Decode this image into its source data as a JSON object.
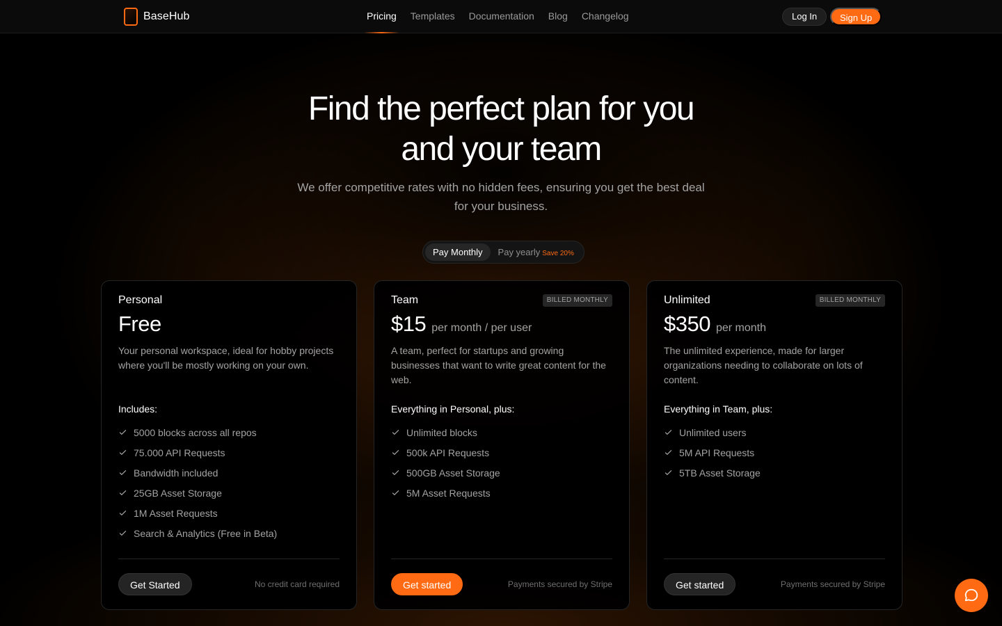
{
  "nav": {
    "brand": "BaseHub",
    "links": [
      {
        "label": "Pricing",
        "active": true
      },
      {
        "label": "Templates"
      },
      {
        "label": "Documentation"
      },
      {
        "label": "Blog"
      },
      {
        "label": "Changelog"
      }
    ],
    "login_label": "Log In",
    "signup_label": "Sign Up"
  },
  "hero": {
    "title_line1": "Find the perfect plan for you",
    "title_line2": "and your team",
    "subtitle": "We offer competitive rates with no hidden fees, ensuring you get the best deal for your business."
  },
  "billing_toggle": {
    "monthly_label": "Pay Monthly",
    "yearly_label": "Pay yearly",
    "save_label": "Save 20%",
    "selected": "monthly"
  },
  "plans": [
    {
      "name": "Personal",
      "badge": "",
      "price": "Free",
      "price_unit": "",
      "description": "Your personal workspace, ideal for hobby projects where you'll be mostly working on your own.",
      "includes_title": "Includes:",
      "features": [
        "5000 blocks across all repos",
        "75.000 API Requests",
        "Bandwidth included",
        "25GB Asset Storage",
        "1M Asset Requests",
        "Search & Analytics (Free in Beta)"
      ],
      "cta_label": "Get Started",
      "cta_note": "No credit card required"
    },
    {
      "name": "Team",
      "badge": "BILLED MONTHLY",
      "price": "$15",
      "price_unit": "per month / per user",
      "description": "A team, perfect for startups and growing businesses that want to write great content for the web.",
      "includes_title": "Everything in Personal, plus:",
      "features": [
        "Unlimited blocks",
        "500k API Requests",
        "500GB Asset Storage",
        "5M Asset Requests"
      ],
      "cta_label": "Get started",
      "cta_note": "Payments secured by Stripe"
    },
    {
      "name": "Unlimited",
      "badge": "BILLED MONTHLY",
      "price": "$350",
      "price_unit": "per month",
      "description": "The unlimited experience, made for larger organizations needing to collaborate on lots of content.",
      "includes_title": "Everything in Team, plus:",
      "features": [
        "Unlimited users",
        "5M API Requests",
        "5TB Asset Storage"
      ],
      "cta_label": "Get started",
      "cta_note": "Payments secured by Stripe"
    }
  ],
  "colors": {
    "accent": "#ff6a13",
    "background": "#000000",
    "muted_text": "#a3a3a3"
  },
  "icons": {
    "feature_bullet": "check-icon",
    "chat": "chat-bubble-icon"
  }
}
